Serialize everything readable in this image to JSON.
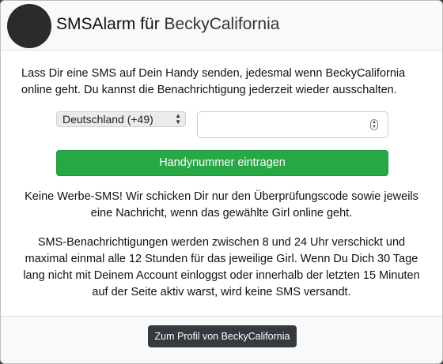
{
  "header": {
    "title_prefix": "SMSAlarm für",
    "model_name": "BeckyCalifornia"
  },
  "intro_text": "Lass Dir eine SMS auf Dein Handy senden, jedesmal wenn BeckyCalifornia online geht. Du kannst die Benachrichtigung jederzeit wieder ausschalten.",
  "form": {
    "country_selected": "Deutschland (+49)",
    "phone_value": "",
    "submit_label": "Handynummer eintragen"
  },
  "notes": {
    "no_ads": "Keine Werbe-SMS! Wir schicken Dir nur den Überprüfungscode sowie jeweils eine Nachricht, wenn das gewählte Girl online geht.",
    "schedule": "SMS-Benachrichtigungen werden zwischen 8 und 24 Uhr verschickt und maximal einmal alle 12 Stunden für das jeweilige Girl. Wenn Du Dich 30 Tage lang nicht mit Deinem Account einloggst oder innerhalb der letzten 15 Minuten auf der Seite aktiv warst, wird keine SMS versandt."
  },
  "footer": {
    "profile_button_label": "Zum Profil von BeckyCalifornia"
  },
  "colors": {
    "submit_green": "#28a745",
    "footer_button_dark": "#343a40"
  }
}
